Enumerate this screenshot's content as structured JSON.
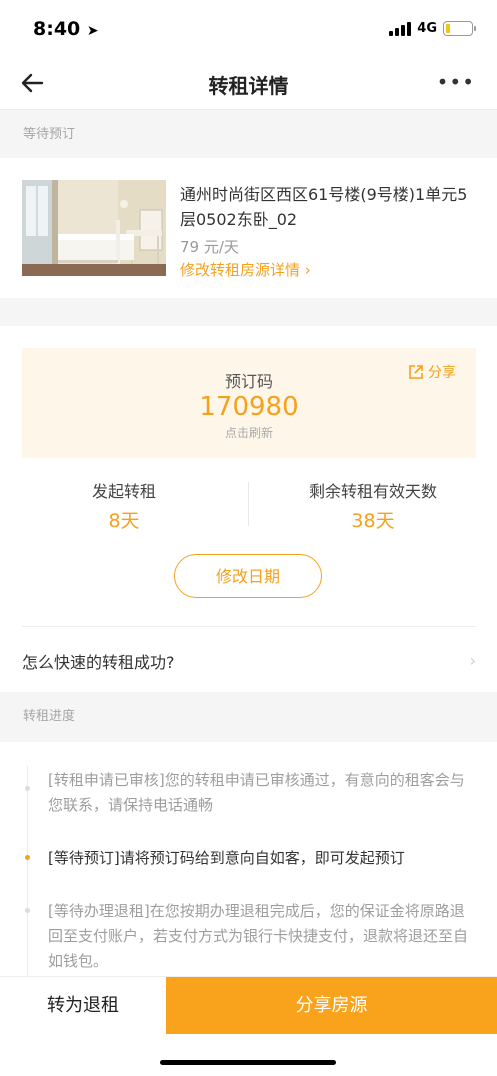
{
  "status_bar": {
    "time": "8:40",
    "network": "4G"
  },
  "nav": {
    "title": "转租详情"
  },
  "status_section": {
    "label": "等待预订"
  },
  "listing": {
    "title": "通州时尚街区西区61号楼(9号楼)1单元5层0502东卧_02",
    "price": "79 元/天",
    "edit_link": "修改转租房源详情 ›"
  },
  "booking": {
    "share_label": "分享",
    "code_label": "预订码",
    "code": "170980",
    "refresh_hint": "点击刷新",
    "started_label": "发起转租",
    "started_value": "8天",
    "remaining_label": "剩余转租有效天数",
    "remaining_value": "38天",
    "modify_button": "修改日期"
  },
  "faq": {
    "text": "怎么快速的转租成功?",
    "arrow": "›"
  },
  "progress": {
    "label": "转租进度",
    "steps": [
      {
        "text": "[转租申请已审核]您的转租申请已审核通过，有意向的租客会与您联系，请保持电话通畅",
        "active": false
      },
      {
        "text": "[等待预订]请将预订码给到意向自如客，即可发起预订",
        "active": true
      },
      {
        "text": "[等待办理退租]在您按期办理退租完成后，您的保证金将原路退回至支付账户，若支付方式为银行卡快捷支付，退款将退还至自如钱包。",
        "active": false
      }
    ]
  },
  "bottom_bar": {
    "checkout_button": "转为退租",
    "share_button": "分享房源"
  },
  "colors": {
    "accent": "#f5a11c",
    "accent_light": "#fff6ea",
    "text_muted": "#9a9a9a"
  },
  "icons": [
    "back-arrow-icon",
    "more-icon",
    "share-icon",
    "chevron-right-icon"
  ]
}
